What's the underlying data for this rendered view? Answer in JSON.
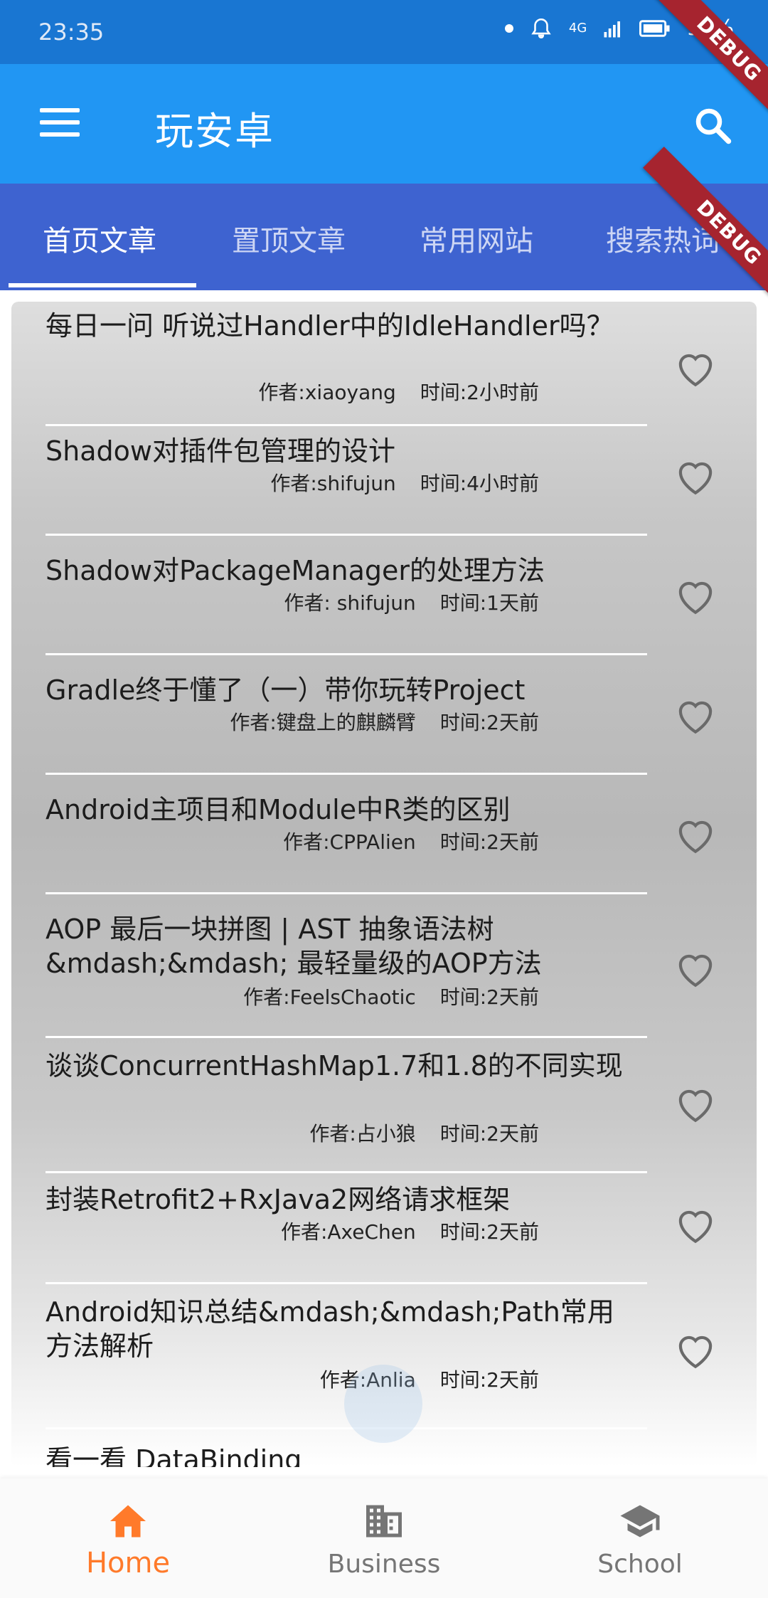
{
  "status_bar": {
    "time": "23:35",
    "network": "4G",
    "battery": "96%"
  },
  "app_bar": {
    "title": "玩安卓",
    "menu_icon": "menu-icon",
    "search_icon": "search-icon"
  },
  "tabs": [
    {
      "label": "首页文章",
      "active": true
    },
    {
      "label": "置顶文章",
      "active": false
    },
    {
      "label": "常用网站",
      "active": false
    },
    {
      "label": "搜索热词",
      "active": false
    }
  ],
  "debug_banner": "DEBUG",
  "articles": [
    {
      "title": "每日一问 听说过Handler中的IdleHandler吗？",
      "author": "作者:xiaoyang",
      "time": "时间:2小时前"
    },
    {
      "title": "Shadow对插件包管理的设计",
      "author": "作者:shifujun",
      "time": "时间:4小时前"
    },
    {
      "title": "Shadow对PackageManager的处理方法",
      "author": "作者: shifujun",
      "time": "时间:1天前"
    },
    {
      "title": "Gradle终于懂了（一）带你玩转Project",
      "author": "作者:键盘上的麒麟臂",
      "time": "时间:2天前"
    },
    {
      "title": "Android主项目和Module中R类的区别",
      "author": "作者:CPPAlien",
      "time": "时间:2天前"
    },
    {
      "title": "AOP 最后一块拼图 | AST 抽象语法树 &mdash;&mdash; 最轻量级的AOP方法",
      "author": "作者:FeelsChaotic",
      "time": "时间:2天前"
    },
    {
      "title": "谈谈ConcurrentHashMap1.7和1.8的不同实现",
      "author": "作者:占小狼",
      "time": "时间:2天前"
    },
    {
      "title": "封装Retrofit2+RxJava2网络请求框架",
      "author": "作者:AxeChen",
      "time": "时间:2天前"
    },
    {
      "title": "Android知识总结&mdash;&mdash;Path常用方法解析",
      "author": "作者:Anlia",
      "time": "时间:2天前"
    },
    {
      "title": "看一看 DataBinding",
      "author": "",
      "time": ""
    }
  ],
  "bottom_nav": [
    {
      "label": "Home",
      "icon": "home-icon",
      "active": true
    },
    {
      "label": "Business",
      "icon": "business-icon",
      "active": false
    },
    {
      "label": "School",
      "icon": "school-icon",
      "active": false
    }
  ],
  "colors": {
    "status_bar": "#1976d2",
    "app_bar": "#2196f3",
    "tab_bar": "#3e63d0",
    "nav_active": "#ff7a2a",
    "nav_inactive": "#757575",
    "debug_ribbon": "#a6242f"
  }
}
